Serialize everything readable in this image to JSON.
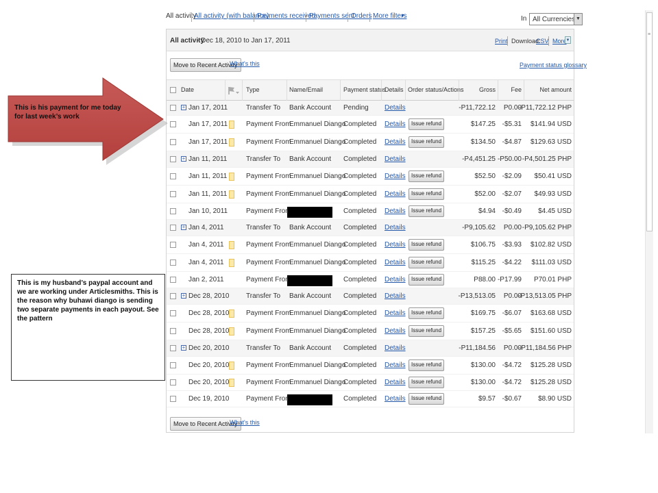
{
  "filters": {
    "all_activity": "All activity",
    "all_activity_balance": "All activity (with balance)",
    "payments_received": "Payments received",
    "payments_sent": "Payments sent",
    "orders": "Orders",
    "more_filters": "More filters",
    "currency_label": "In",
    "currency_value": "All Currencies"
  },
  "panel": {
    "title": "All activity",
    "range": " - Dec 18, 2010 to Jan 17, 2011",
    "print": "Print",
    "download_label": "Download:",
    "csv": "CSV",
    "more": "More",
    "move_button": "Move to Recent Activity",
    "whats_this": "What's this",
    "glossary": "Payment status glossary"
  },
  "columns": {
    "date": "Date",
    "type": "Type",
    "name": "Name/Email",
    "status": "Payment status",
    "details": "Details",
    "order": "Order status/Actions",
    "gross": "Gross",
    "fee": "Fee",
    "net": "Net amount"
  },
  "transactions": [
    {
      "date": "Jan 17, 2011",
      "expand": true,
      "note": false,
      "type": "Transfer To",
      "name": "Bank Account",
      "redacted": false,
      "status": "Pending",
      "details": "Details",
      "refund": "",
      "gross": "-P11,722.12",
      "fee": "P0.00",
      "net": "-P11,722.12 PHP"
    },
    {
      "date": "Jan 17, 2011",
      "expand": false,
      "note": true,
      "type": "Payment From",
      "name": "Emmanuel Diango",
      "redacted": false,
      "status": "Completed",
      "details": "Details",
      "refund": "Issue refund",
      "gross": "$147.25",
      "fee": "-$5.31",
      "net": "$141.94 USD"
    },
    {
      "date": "Jan 17, 2011",
      "expand": false,
      "note": true,
      "type": "Payment From",
      "name": "Emmanuel Diango",
      "redacted": false,
      "status": "Completed",
      "details": "Details",
      "refund": "Issue refund",
      "gross": "$134.50",
      "fee": "-$4.87",
      "net": "$129.63 USD"
    },
    {
      "date": "Jan 11, 2011",
      "expand": true,
      "note": false,
      "type": "Transfer To",
      "name": "Bank Account",
      "redacted": false,
      "status": "Completed",
      "details": "Details",
      "refund": "",
      "gross": "-P4,451.25",
      "fee": "-P50.00",
      "net": "-P4,501.25 PHP"
    },
    {
      "date": "Jan 11, 2011",
      "expand": false,
      "note": true,
      "type": "Payment From",
      "name": "Emmanuel Diango",
      "redacted": false,
      "status": "Completed",
      "details": "Details",
      "refund": "Issue refund",
      "gross": "$52.50",
      "fee": "-$2.09",
      "net": "$50.41 USD"
    },
    {
      "date": "Jan 11, 2011",
      "expand": false,
      "note": true,
      "type": "Payment From",
      "name": "Emmanuel Diango",
      "redacted": false,
      "status": "Completed",
      "details": "Details",
      "refund": "Issue refund",
      "gross": "$52.00",
      "fee": "-$2.07",
      "net": "$49.93 USD"
    },
    {
      "date": "Jan 10, 2011",
      "expand": false,
      "note": false,
      "type": "Payment From",
      "name": "",
      "redacted": true,
      "status": "Completed",
      "details": "Details",
      "refund": "Issue refund",
      "gross": "$4.94",
      "fee": "-$0.49",
      "net": "$4.45 USD"
    },
    {
      "date": "Jan 4, 2011",
      "expand": true,
      "note": false,
      "type": "Transfer To",
      "name": "Bank Account",
      "redacted": false,
      "status": "Completed",
      "details": "Details",
      "refund": "",
      "gross": "-P9,105.62",
      "fee": "P0.00",
      "net": "-P9,105.62 PHP"
    },
    {
      "date": "Jan 4, 2011",
      "expand": false,
      "note": true,
      "type": "Payment From",
      "name": "Emmanuel Diango",
      "redacted": false,
      "status": "Completed",
      "details": "Details",
      "refund": "Issue refund",
      "gross": "$106.75",
      "fee": "-$3.93",
      "net": "$102.82 USD"
    },
    {
      "date": "Jan 4, 2011",
      "expand": false,
      "note": true,
      "type": "Payment From",
      "name": "Emmanuel Diango",
      "redacted": false,
      "status": "Completed",
      "details": "Details",
      "refund": "Issue refund",
      "gross": "$115.25",
      "fee": "-$4.22",
      "net": "$111.03 USD"
    },
    {
      "date": "Jan 2, 2011",
      "expand": false,
      "note": false,
      "type": "Payment From",
      "name": "",
      "redacted": true,
      "status": "Completed",
      "details": "Details",
      "refund": "Issue refund",
      "gross": "P88.00",
      "fee": "-P17.99",
      "net": "P70.01 PHP"
    },
    {
      "date": "Dec 28, 2010",
      "expand": true,
      "note": false,
      "type": "Transfer To",
      "name": "Bank Account",
      "redacted": false,
      "status": "Completed",
      "details": "Details",
      "refund": "",
      "gross": "-P13,513.05",
      "fee": "P0.00",
      "net": "-P13,513.05 PHP"
    },
    {
      "date": "Dec 28, 2010",
      "expand": false,
      "note": true,
      "type": "Payment From",
      "name": "Emmanuel Diango",
      "redacted": false,
      "status": "Completed",
      "details": "Details",
      "refund": "Issue refund",
      "gross": "$169.75",
      "fee": "-$6.07",
      "net": "$163.68 USD"
    },
    {
      "date": "Dec 28, 2010",
      "expand": false,
      "note": true,
      "type": "Payment From",
      "name": "Emmanuel Diango",
      "redacted": false,
      "status": "Completed",
      "details": "Details",
      "refund": "Issue refund",
      "gross": "$157.25",
      "fee": "-$5.65",
      "net": "$151.60 USD"
    },
    {
      "date": "Dec 20, 2010",
      "expand": true,
      "note": false,
      "type": "Transfer To",
      "name": "Bank Account",
      "redacted": false,
      "status": "Completed",
      "details": "Details",
      "refund": "",
      "gross": "-P11,184.56",
      "fee": "P0.00",
      "net": "-P11,184.56 PHP"
    },
    {
      "date": "Dec 20, 2010",
      "expand": false,
      "note": true,
      "type": "Payment From",
      "name": "Emmanuel Diango",
      "redacted": false,
      "status": "Completed",
      "details": "Details",
      "refund": "Issue refund",
      "gross": "$130.00",
      "fee": "-$4.72",
      "net": "$125.28 USD"
    },
    {
      "date": "Dec 20, 2010",
      "expand": false,
      "note": true,
      "type": "Payment From",
      "name": "Emmanuel Diango",
      "redacted": false,
      "status": "Completed",
      "details": "Details",
      "refund": "Issue refund",
      "gross": "$130.00",
      "fee": "-$4.72",
      "net": "$125.28 USD"
    },
    {
      "date": "Dec 19, 2010",
      "expand": false,
      "note": false,
      "type": "Payment From",
      "name": "",
      "redacted": true,
      "status": "Completed",
      "details": "Details",
      "refund": "Issue refund",
      "gross": "$9.57",
      "fee": "-$0.67",
      "net": "$8.90 USD"
    }
  ],
  "annotations": {
    "arrow_text": "This is his payment for me today for last week’s work",
    "note_text": "This is my husband’s paypal account and we are working under Articlesmiths. This is the reason why buhawi diango is sending two separate payments in each payout.  See the pattern",
    "arrow_color": "#c0504d"
  }
}
